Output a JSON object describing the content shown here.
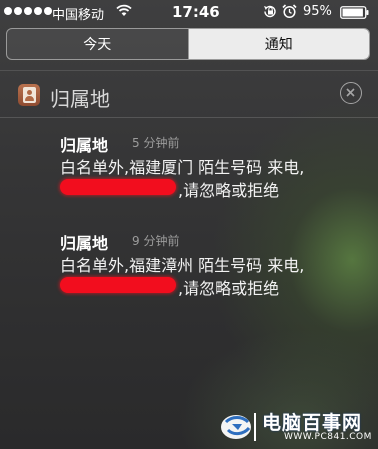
{
  "status_bar": {
    "carrier": "中国移动",
    "time": "17:46",
    "battery_percent": "95%",
    "battery_level": 0.95,
    "signal_bars": 5,
    "icons": [
      "signal-dots-icon",
      "wifi-icon",
      "rotation-lock-icon",
      "alarm-icon",
      "battery-icon"
    ]
  },
  "tabs": {
    "today_label": "今天",
    "notifications_label": "通知",
    "selected": "通知"
  },
  "section": {
    "app_name": "归属地",
    "app_icon": "contacts-app-icon",
    "close_icon": "close-icon"
  },
  "notifications": [
    {
      "title": "归属地",
      "time": "5 分钟前",
      "line1": "白名单外,福建厦门 陌生号码 来电,",
      "line2_suffix": ",请忽略或拒绝"
    },
    {
      "title": "归属地",
      "time": "9 分钟前",
      "line1": "白名单外,福建漳州 陌生号码 来电,",
      "line2_suffix": ",请忽略或拒绝"
    }
  ],
  "watermark": {
    "name": "电脑百事网",
    "url": "WWW.PC841.COM"
  },
  "colors": {
    "selected_tab_bg": "#ececec",
    "redaction": "#f20d1e",
    "app_icon": "#a35d3f"
  }
}
